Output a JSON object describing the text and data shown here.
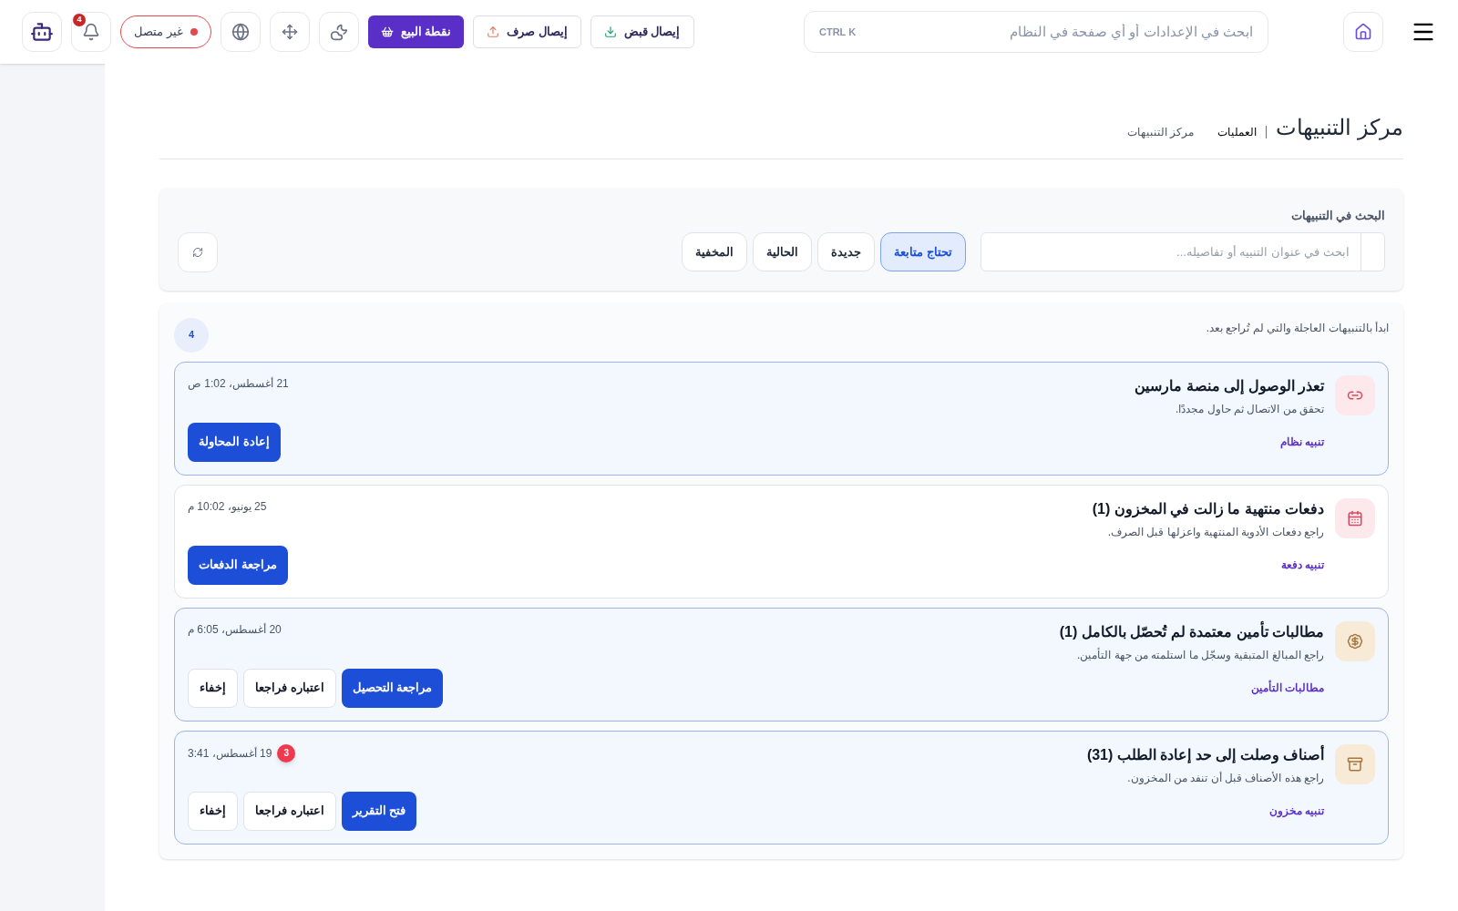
{
  "header": {
    "search_placeholder": "ابحث في الإعدادات أو أي صفحة في النظام",
    "shortcut": "CTRL K",
    "actions": [
      {
        "kind": "receipt-in",
        "label": "إيصال قبض"
      },
      {
        "kind": "receipt-out",
        "label": "إيصال صرف"
      },
      {
        "kind": "pos",
        "label": "نقطة البيع"
      }
    ],
    "status": {
      "label": "غير متصل",
      "online": false
    },
    "notifications_count": "4"
  },
  "page": {
    "title": "مركز التنبيهات",
    "breadcrumbs": [
      "العمليات",
      "مركز التنبيهات"
    ]
  },
  "filters": {
    "search_label": "البحث في التنبيهات",
    "search_placeholder": "ابحث في عنوان التنبيه أو تفاصيله...",
    "tabs": [
      {
        "label": "تحتاج متابعة",
        "selected": true
      },
      {
        "label": "جديدة",
        "selected": false
      },
      {
        "label": "الحالية",
        "selected": false
      },
      {
        "label": "المخفية",
        "selected": false
      }
    ]
  },
  "list": {
    "hint": "ابدأ بالتنبيهات العاجلة والتي لم تُراجع بعد.",
    "count": "4",
    "alerts": [
      {
        "kind": "link",
        "unread": true,
        "title": "تعذر الوصول إلى منصة مارسين",
        "detail": "تحقق من الاتصال ثم حاول مجددًا.",
        "category": "تنبيه نظام",
        "time": "21 أغسطس، 1:02 ص",
        "buttons": [
          {
            "kind": "primary",
            "label": "إعادة المحاولة"
          }
        ]
      },
      {
        "kind": "calendar",
        "unread": false,
        "title": "دفعات منتهية ما زالت في المخزون (1)",
        "detail": "راجع دفعات الأدوية المنتهية واعزلها قبل الصرف.",
        "category": "تنبيه دفعة",
        "time": "25 يونيو، 10:02 م",
        "buttons": [
          {
            "kind": "primary",
            "label": "مراجعة الدفعات"
          }
        ]
      },
      {
        "kind": "money",
        "unread": true,
        "title": "مطالبات تأمين معتمدة لم تُحصّل بالكامل (1)",
        "detail": "راجع المبالغ المتبقية وسجّل ما استلمته من جهة التأمين.",
        "category": "مطالبات التأمين",
        "time": "20 أغسطس، 6:05 م",
        "buttons": [
          {
            "kind": "primary",
            "label": "مراجعة التحصيل"
          },
          {
            "kind": "secondary",
            "label": "اعتباره فراجعا"
          },
          {
            "kind": "secondary",
            "label": "إخفاء"
          }
        ]
      },
      {
        "kind": "box",
        "unread": true,
        "title": "أصناف وصلت إلى حد إعادة الطلب (31)",
        "detail": "راجع هذه الأصناف قبل أن تنفد من المخزون.",
        "category": "تنبيه مخزون",
        "time": "19 أغسطس، 3:41",
        "buttons": [
          {
            "kind": "primary",
            "label": "فتح التقرير"
          },
          {
            "kind": "secondary",
            "label": "اعتباره فراجعا"
          },
          {
            "kind": "secondary",
            "label": "إخفاء"
          }
        ]
      }
    ]
  },
  "floating_badge": "3"
}
